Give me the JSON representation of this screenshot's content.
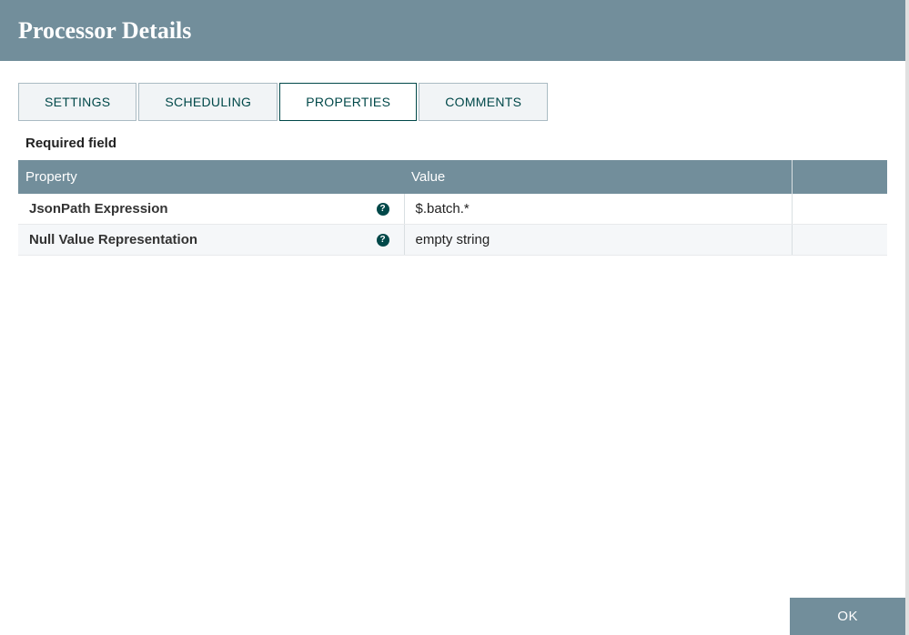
{
  "header": {
    "title": "Processor Details"
  },
  "tabs": [
    {
      "label": "SETTINGS",
      "active": false
    },
    {
      "label": "SCHEDULING",
      "active": false
    },
    {
      "label": "PROPERTIES",
      "active": true
    },
    {
      "label": "COMMENTS",
      "active": false
    }
  ],
  "section_label": "Required field",
  "table": {
    "headers": {
      "property": "Property",
      "value": "Value"
    },
    "rows": [
      {
        "property": "JsonPath Expression",
        "value": "$.batch.*"
      },
      {
        "property": "Null Value Representation",
        "value": "empty string"
      }
    ]
  },
  "buttons": {
    "ok": "OK"
  },
  "icons": {
    "help": "?"
  }
}
